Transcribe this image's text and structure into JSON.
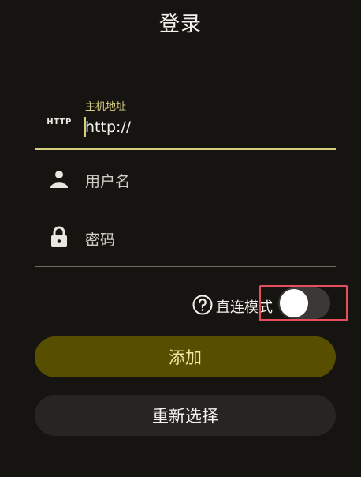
{
  "page": {
    "title": "登录"
  },
  "form": {
    "host": {
      "tag": "HTTP",
      "label": "主机地址",
      "value": "http://"
    },
    "username": {
      "placeholder": "用户名",
      "icon": "person-icon"
    },
    "password": {
      "placeholder": "密码",
      "icon": "lock-icon"
    },
    "direct_mode": {
      "label": "直连模式",
      "enabled": false,
      "help_icon": "question-circle-icon"
    }
  },
  "buttons": {
    "add": "添加",
    "reselect": "重新选择"
  },
  "colors": {
    "accent": "#d8cf7e",
    "add_bg": "#574e00",
    "highlight": "#e84d5e"
  }
}
